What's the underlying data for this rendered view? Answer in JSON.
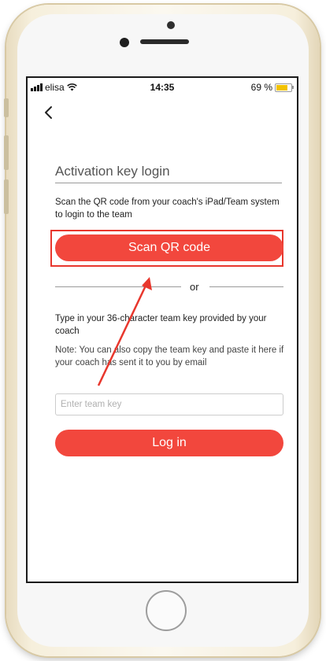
{
  "status": {
    "carrier": "elisa",
    "time": "14:35",
    "battery": "69 %",
    "battery_level": 0.69
  },
  "nav": {
    "back_icon": "chevron-left-icon"
  },
  "activation": {
    "title": "Activation key login",
    "scan_instruction": "Scan the QR code from your coach's iPad/Team system to login to the team",
    "scan_button": "Scan QR code",
    "divider": "or",
    "type_instruction": "Type in your 36-character team key provided by your coach",
    "note": "Note: You can also copy the team key and paste it here if your coach has sent it to you by email",
    "team_key": {
      "value": "",
      "placeholder": "Enter team key"
    },
    "login_button": "Log in"
  },
  "colors": {
    "accent": "#f2473d",
    "annotation": "#e8372d",
    "battery": "#f2c200"
  }
}
